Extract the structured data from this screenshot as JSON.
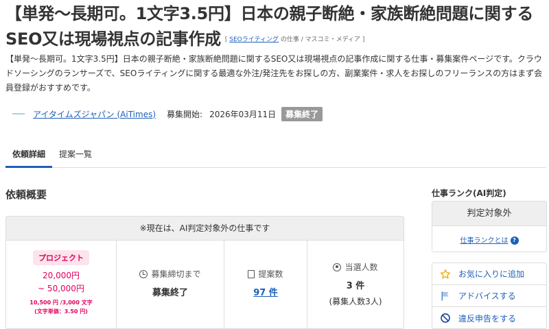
{
  "title": {
    "line1": "【単発〜長期可。1文字3.5円】日本の親子断絶・家族断絶問題に関する",
    "line2": "SEO又は現場視点の記事作成",
    "category_open": "[ ",
    "category_link": "SEOライティング",
    "category_rest": " の仕事 / マスコミ・メディア ]"
  },
  "description": "【単発〜長期可。1文字3.5円】日本の親子断絶・家族断絶問題に関するSEO又は現場視点の記事作成に関する仕事・募集案件ページです。クラウドソーシングのランサーズで、SEOライティングに関する最適な外注/発注先をお探しの方、副業案件・求人をお探しのフリーランスの方はまず会員登録がおすすめです。",
  "client": {
    "name": "アイタイムズジャパン (AiTimes)",
    "start_label": "募集開始:",
    "start_date": "2026年03月11日",
    "status_badge": "募集終了"
  },
  "tabs": [
    {
      "label": "依頼詳細",
      "active": true
    },
    {
      "label": "提案一覧",
      "active": false
    }
  ],
  "overview": {
    "heading": "依頼概要",
    "banner": "※現在は、AI判定対象外の仕事です",
    "type_pill": "プロジェクト",
    "price_min": "20,000円",
    "price_max": "~ 50,000円",
    "word_info": "10,500 円 /3,000 文字",
    "word_unit": "(文字単価：3.50 円)",
    "deadline_label": "募集締切まで",
    "deadline_value": "募集終了",
    "proposals_label": "提案数",
    "proposals_value": "97 件",
    "selected_label": "当選人数",
    "selected_value": "3 件",
    "selected_sub": "(募集人数3人)"
  },
  "rank": {
    "heading": "仕事ランク(AI判定)",
    "value": "判定対象外",
    "link": "仕事ランクとは",
    "help": "?"
  },
  "actions": [
    {
      "label": "お気に入りに追加",
      "icon": "star-icon"
    },
    {
      "label": "アドバイスする",
      "icon": "flag-icon"
    },
    {
      "label": "違反申告をする",
      "icon": "prohibit-icon"
    }
  ],
  "colors": {
    "accent": "#1d5fb7",
    "price": "#e0005e",
    "pill_bg": "#fce4ec",
    "closed_badge": "#999999"
  }
}
